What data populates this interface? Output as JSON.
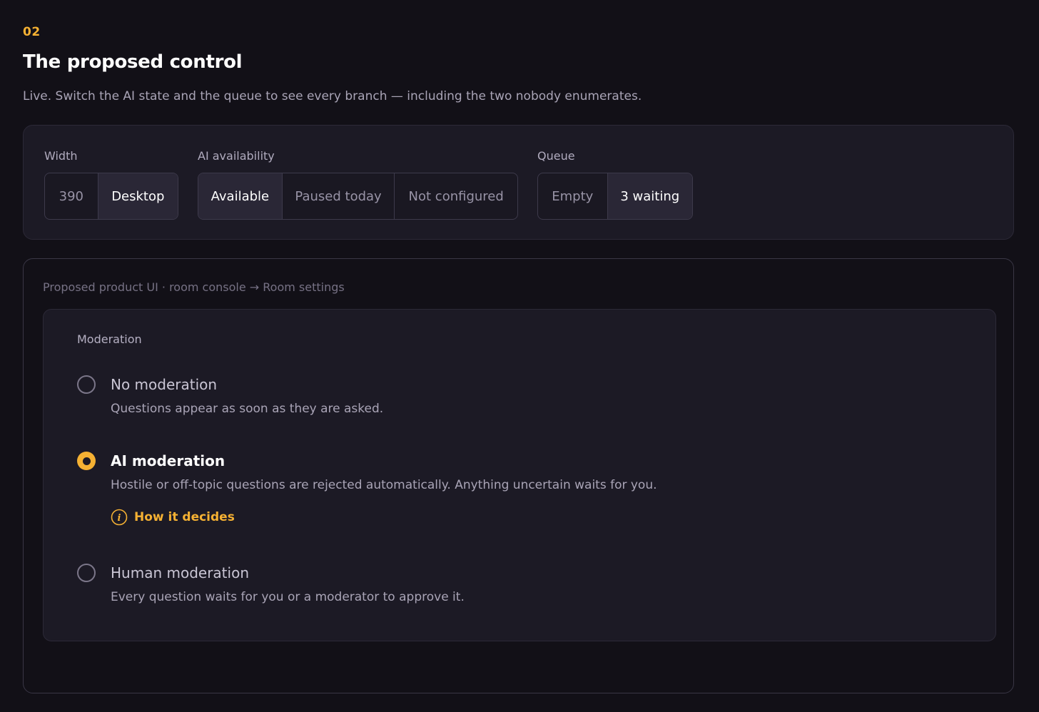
{
  "header": {
    "eyebrow": "02",
    "title": "The proposed control",
    "subtitle": "Live. Switch the AI state and the queue to see every branch — including the two nobody enumerates."
  },
  "controls": {
    "width": {
      "label": "Width",
      "options": [
        "390",
        "Desktop"
      ],
      "selected": "Desktop"
    },
    "ai_availability": {
      "label": "AI availability",
      "options": [
        "Available",
        "Paused today",
        "Not configured"
      ],
      "selected": "Available"
    },
    "queue": {
      "label": "Queue",
      "options": [
        "Empty",
        "3 waiting"
      ],
      "selected": "3 waiting"
    }
  },
  "preview": {
    "breadcrumb": "Proposed product UI · room console → Room settings",
    "section_label": "Moderation",
    "options": [
      {
        "title": "No moderation",
        "description": "Questions appear as soon as they are asked.",
        "selected": false
      },
      {
        "title": "AI moderation",
        "description": "Hostile or off-topic questions are rejected automatically. Anything uncertain waits for you.",
        "selected": true,
        "link": "How it decides"
      },
      {
        "title": "Human moderation",
        "description": "Every question waits for you or a moderator to approve it.",
        "selected": false
      }
    ]
  },
  "colors": {
    "accent": "#f5b133",
    "background": "#121017",
    "panel": "#1c1a25"
  },
  "icons": {
    "info": "info-circle-icon"
  }
}
